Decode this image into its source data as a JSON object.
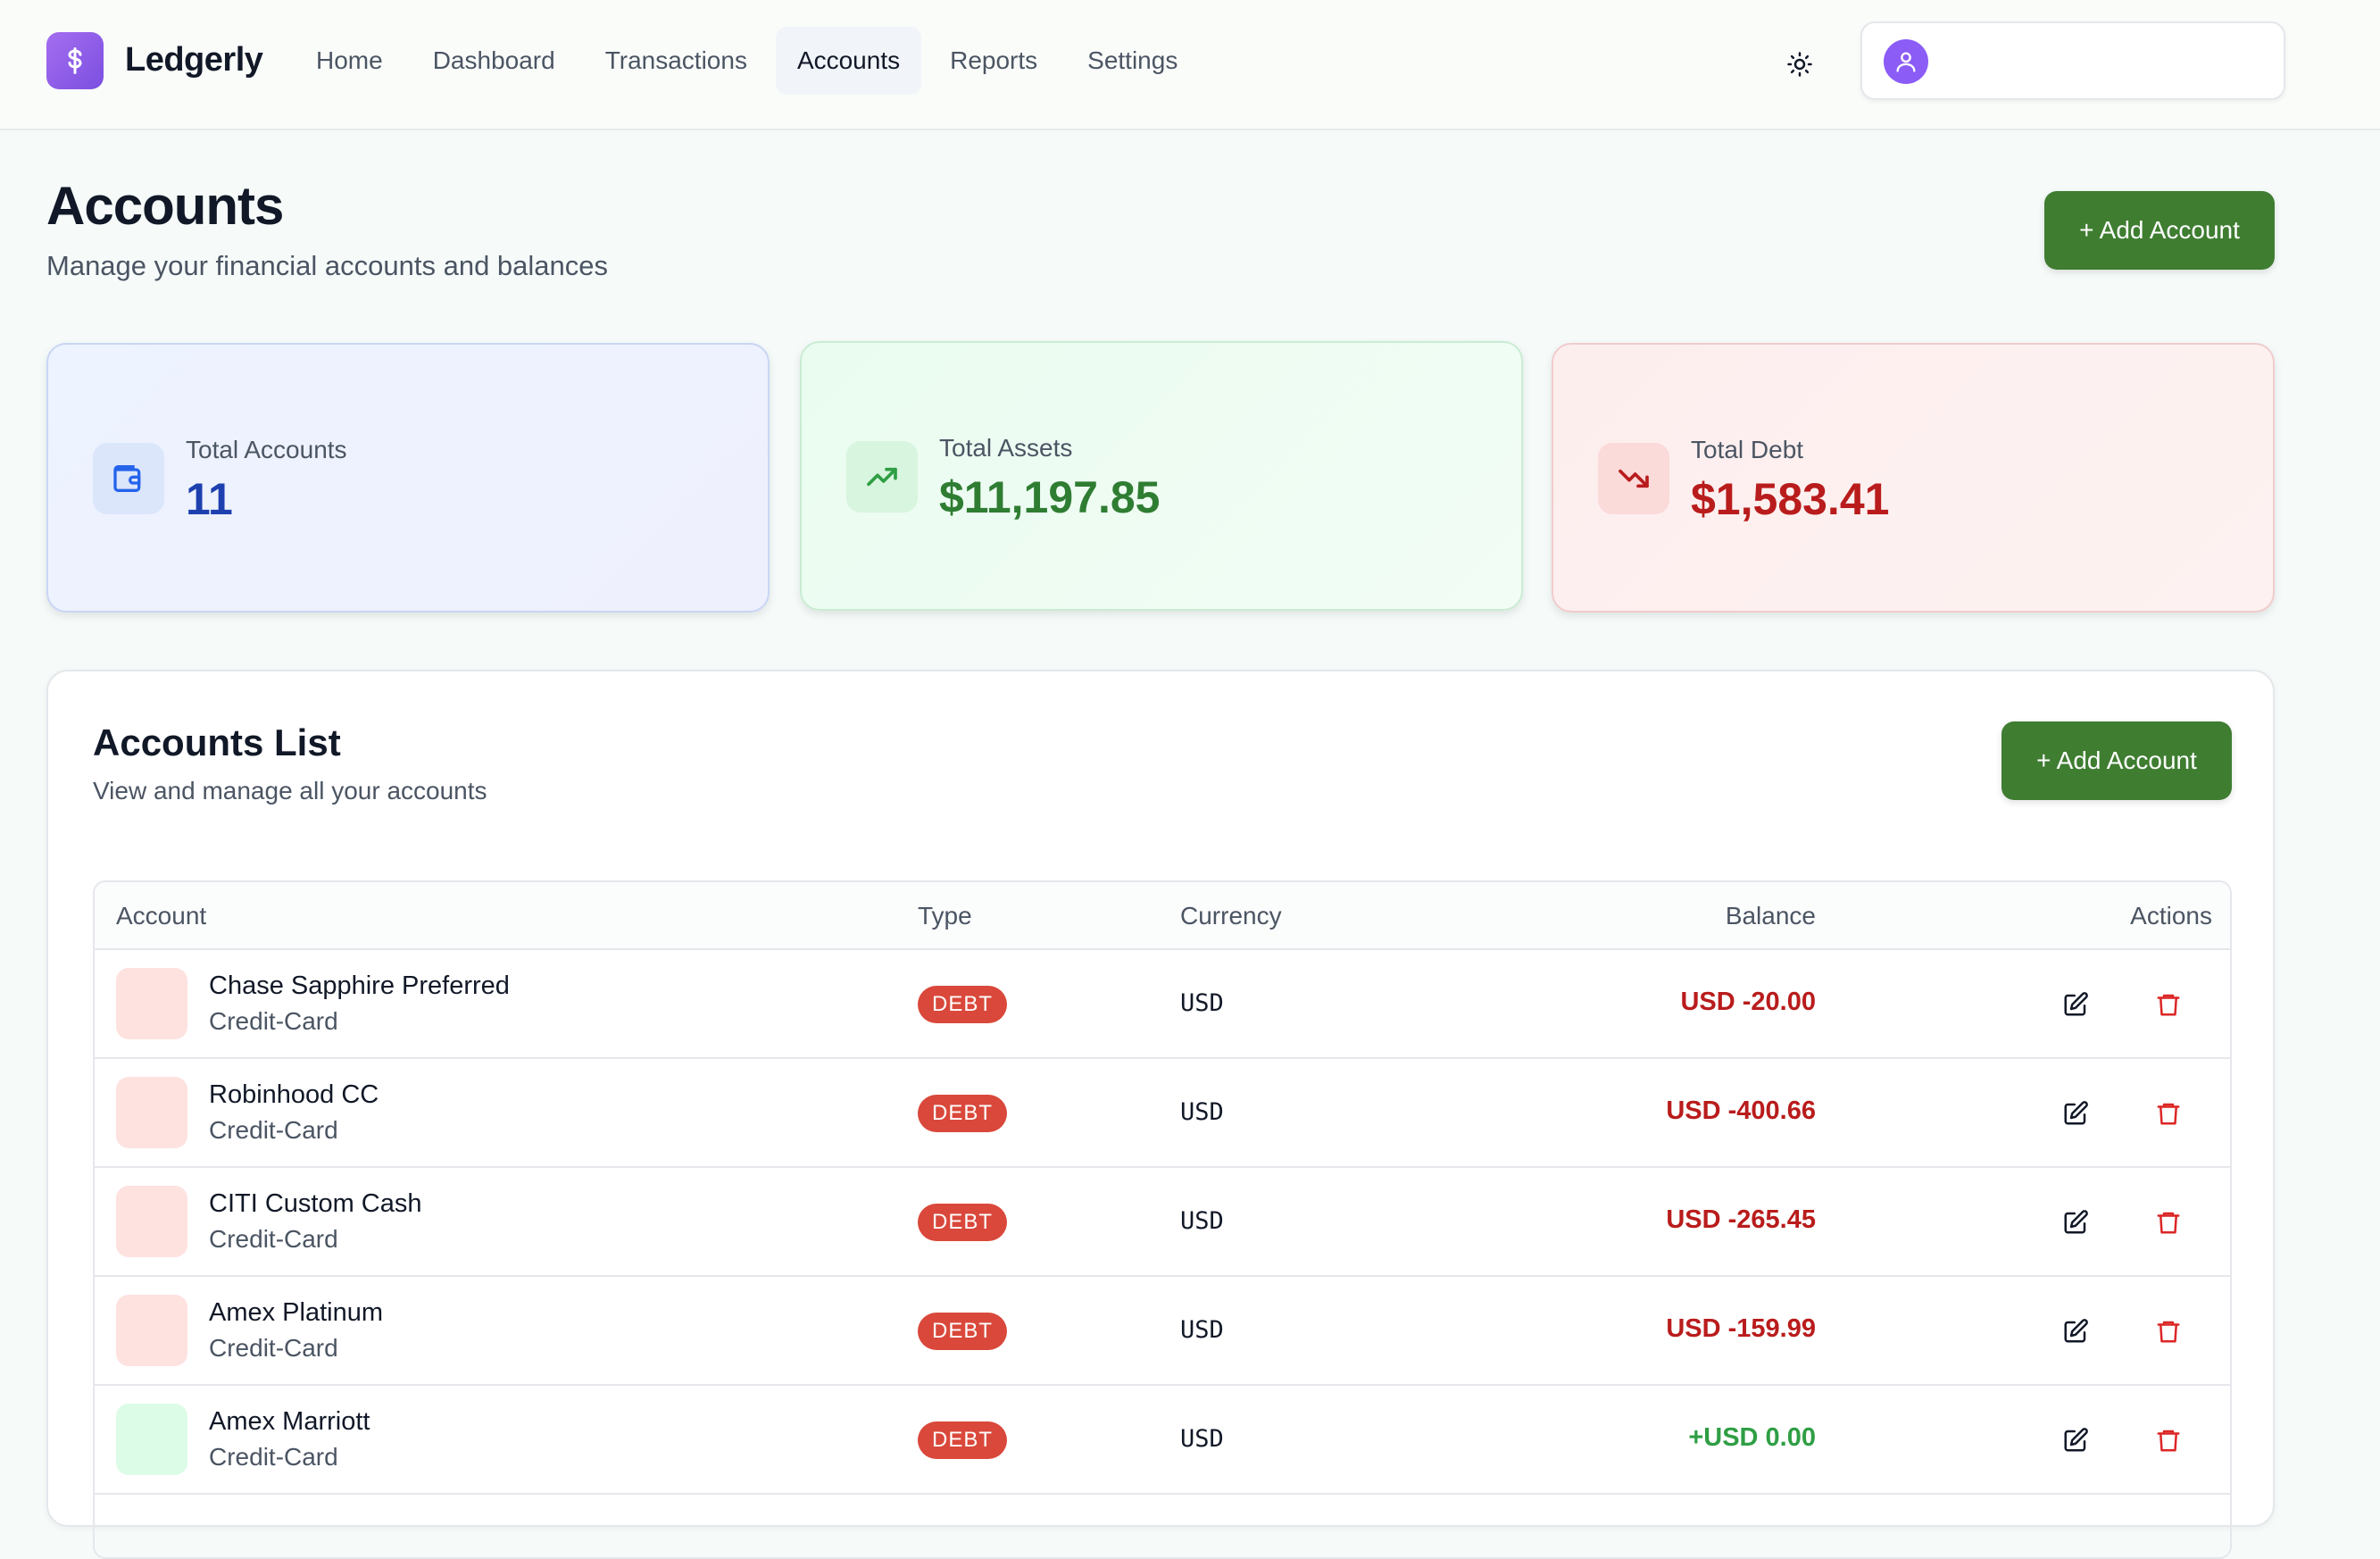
{
  "app": {
    "name": "Ledgerly",
    "logo_symbol": "$"
  },
  "nav": [
    {
      "label": "Home",
      "active": false
    },
    {
      "label": "Dashboard",
      "active": false
    },
    {
      "label": "Transactions",
      "active": false
    },
    {
      "label": "Accounts",
      "active": true
    },
    {
      "label": "Reports",
      "active": false
    },
    {
      "label": "Settings",
      "active": false
    }
  ],
  "icons": {
    "theme": "sun-icon",
    "user": "user-icon",
    "edit": "edit-icon",
    "delete": "trash-icon"
  },
  "page": {
    "title": "Accounts",
    "subtitle": "Manage your financial accounts and balances",
    "add_button": "+ Add Account"
  },
  "summary": {
    "total_accounts": {
      "label": "Total Accounts",
      "value": "11"
    },
    "total_assets": {
      "label": "Total Assets",
      "value": "$11,197.85"
    },
    "total_debt": {
      "label": "Total Debt",
      "value": "$1,583.41"
    }
  },
  "list": {
    "title": "Accounts List",
    "subtitle": "View and manage all your accounts",
    "add_button": "+ Add Account",
    "columns": {
      "account": "Account",
      "type": "Type",
      "currency": "Currency",
      "balance": "Balance",
      "actions": "Actions"
    },
    "rows": [
      {
        "name": "Chase Sapphire Preferred",
        "subtype": "Credit-Card",
        "type": "DEBT",
        "currency": "USD",
        "balance": "USD -20.00"
      },
      {
        "name": "Robinhood CC",
        "subtype": "Credit-Card",
        "type": "DEBT",
        "currency": "USD",
        "balance": "USD -400.66"
      },
      {
        "name": "CITI Custom Cash",
        "subtype": "Credit-Card",
        "type": "DEBT",
        "currency": "USD",
        "balance": "USD -265.45"
      },
      {
        "name": "Amex Platinum",
        "subtype": "Credit-Card",
        "type": "DEBT",
        "currency": "USD",
        "balance": "USD -159.99"
      },
      {
        "name": "Amex Marriott",
        "subtype": "Credit-Card",
        "type": "DEBT",
        "currency": "USD",
        "balance": "+USD 0.00"
      }
    ]
  },
  "colors": {
    "brand": "#8b5cf6",
    "primary_button": "#3f7d31",
    "debt_badge": "#d9483b",
    "negative": "#b91c1c",
    "positive": "#2f9e44",
    "debt_icon_bg": "#fde2e0",
    "positive_icon_bg": "#dcfce7"
  }
}
